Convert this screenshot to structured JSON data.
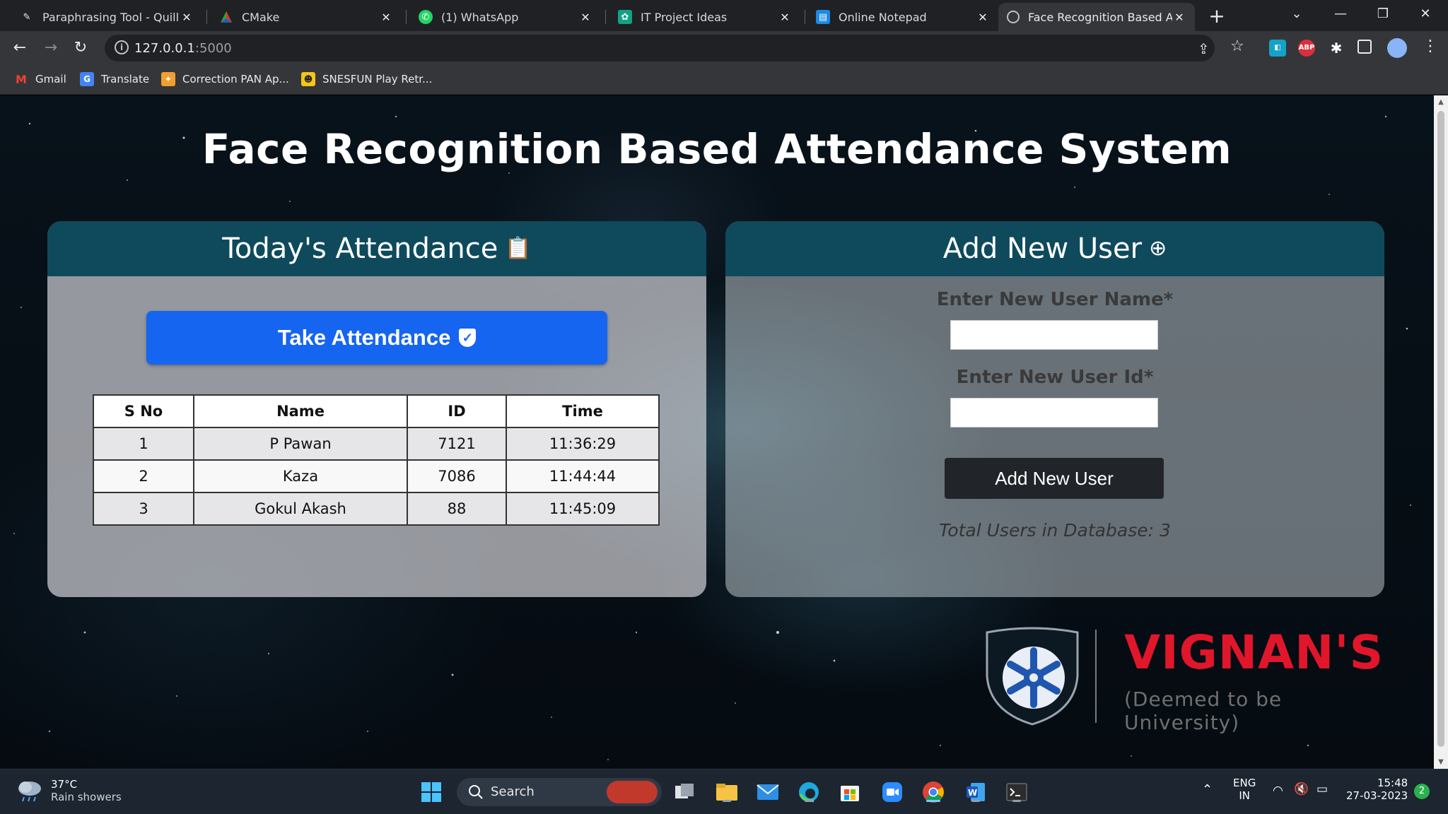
{
  "browser": {
    "tabs": [
      {
        "title": "Paraphrasing Tool - QuillBo",
        "icon": "quillbot-icon"
      },
      {
        "title": "CMake",
        "icon": "cmake-icon"
      },
      {
        "title": "(1) WhatsApp",
        "icon": "whatsapp-icon"
      },
      {
        "title": "IT Project Ideas",
        "icon": "chatgpt-icon"
      },
      {
        "title": "Online Notepad",
        "icon": "notepad-icon"
      },
      {
        "title": "Face Recognition Based Att",
        "icon": "globe-icon",
        "active": true
      }
    ],
    "address": {
      "host": "127.0.0.1",
      "port": ":5000"
    },
    "bookmarks": [
      "Gmail",
      "Translate",
      "Correction PAN Ap...",
      "SNESFUN Play Retr..."
    ]
  },
  "page": {
    "title": "Face Recognition Based Attendance System",
    "attendance_panel": {
      "heading": "Today's Attendance",
      "take_button": "Take Attendance",
      "columns": [
        "S No",
        "Name",
        "ID",
        "Time"
      ],
      "rows": [
        [
          "1",
          "P Pawan",
          "7121",
          "11:36:29"
        ],
        [
          "2",
          "Kaza",
          "7086",
          "11:44:44"
        ],
        [
          "3",
          "Gokul Akash",
          "88",
          "11:45:09"
        ]
      ]
    },
    "add_user_panel": {
      "heading": "Add New User",
      "name_label": "Enter New User Name*",
      "id_label": "Enter New User Id*",
      "name_value": "",
      "id_value": "",
      "button": "Add New User",
      "total": "Total Users in Database: 3"
    },
    "logo": {
      "name": "VIGNAN'S",
      "subtitle": "(Deemed to be University)"
    }
  },
  "taskbar": {
    "weather": {
      "temp": "37°C",
      "desc": "Rain showers"
    },
    "search_label": "Search",
    "lang": {
      "line1": "ENG",
      "line2": "IN"
    },
    "clock": {
      "time": "15:48",
      "date": "27-03-2023"
    },
    "notifications": "2"
  },
  "colors": {
    "accent_button": "#1565f0",
    "panel_header": "#0e4a5c",
    "logo_red": "#e0162b"
  }
}
